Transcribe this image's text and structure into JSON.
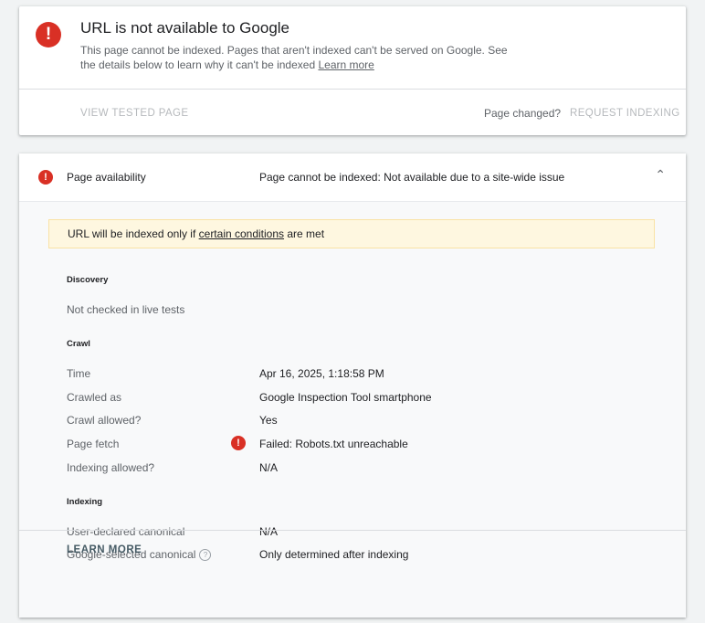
{
  "summary": {
    "title": "URL is not available to Google",
    "description": "This page cannot be indexed. Pages that aren't indexed can't be served on Google. See the details below to learn why it can't be indexed",
    "learn_more_link": "Learn more",
    "view_tested_page": "VIEW TESTED PAGE",
    "page_changed": "Page changed?",
    "request_indexing": "REQUEST INDEXING"
  },
  "availability": {
    "label": "Page availability",
    "status": "Page cannot be indexed: Not available due to a site-wide issue",
    "notice_prefix": "URL will be indexed only if",
    "notice_link": "certain conditions",
    "notice_suffix": "are met",
    "discovery": {
      "heading": "Discovery",
      "text": "Not checked in live tests"
    },
    "crawl": {
      "heading": "Crawl",
      "rows": [
        {
          "label": "Time",
          "value": "Apr 16, 2025, 1:18:58 PM"
        },
        {
          "label": "Crawled as",
          "value": "Google Inspection Tool smartphone"
        },
        {
          "label": "Crawl allowed?",
          "value": "Yes"
        },
        {
          "label": "Page fetch",
          "value": "Failed: Robots.txt unreachable"
        },
        {
          "label": "Indexing allowed?",
          "value": "N/A"
        }
      ]
    },
    "indexing": {
      "heading": "Indexing",
      "rows": [
        {
          "label": "User-declared canonical",
          "value": "N/A"
        },
        {
          "label": "Google-selected canonical",
          "value": "Only determined after indexing"
        }
      ]
    },
    "learn_more": "LEARN MORE"
  },
  "colors": {
    "error": "#d93025",
    "notice_bg": "#fef7e0",
    "disabled_action": "#b6b9bc"
  }
}
